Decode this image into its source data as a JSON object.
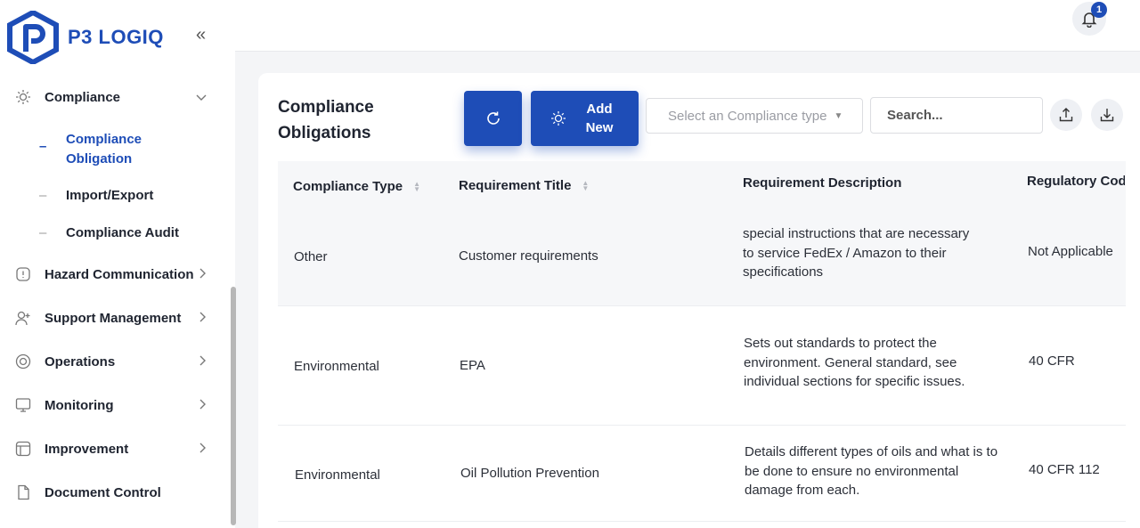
{
  "app": {
    "name": "P3 LOGIQ"
  },
  "sidebar": {
    "collapse_icon": "«",
    "compliance": {
      "label": "Compliance",
      "expanded": true,
      "subitems": [
        {
          "label": "Compliance Obligation",
          "active": true
        },
        {
          "label": "Import/Export",
          "active": false
        },
        {
          "label": "Compliance Audit",
          "active": false
        }
      ]
    },
    "items": [
      {
        "label": "Hazard Communication",
        "icon": "hazard-icon"
      },
      {
        "label": "Support Management",
        "icon": "user-plus-icon"
      },
      {
        "label": "Operations",
        "icon": "operations-icon"
      },
      {
        "label": "Monitoring",
        "icon": "monitor-icon"
      },
      {
        "label": "Improvement",
        "icon": "improvement-icon"
      },
      {
        "label": "Document Control",
        "icon": "document-icon"
      }
    ]
  },
  "header": {
    "notifications_count": "1"
  },
  "main": {
    "title": "Compliance Obligations",
    "add_button_label": "Add New",
    "type_select_placeholder": "Select an Compliance type",
    "search_placeholder": "Search...",
    "table": {
      "columns": [
        "Compliance Type",
        "Requirement Title",
        "Requirement Description",
        "Regulatory Cod"
      ],
      "rows": [
        {
          "type": "Other",
          "title": "Customer requirements",
          "description": "special instructions that are necessary to service FedEx / Amazon to their specifications",
          "code": "Not Applicable"
        },
        {
          "type": "Environmental",
          "title": "EPA",
          "description": "Sets out standards to protect the environment. General standard, see individual sections for specific issues.",
          "code": "40 CFR"
        },
        {
          "type": "Environmental",
          "title": "Oil Pollution Prevention",
          "description": "Details different types of oils and what is to be done to ensure no environmental damage from each.",
          "code": "40 CFR 112"
        }
      ]
    }
  },
  "colors": {
    "brand": "#1e4db7",
    "sidebar_bg": "#ffffff",
    "page_bg": "#f4f5f7"
  }
}
